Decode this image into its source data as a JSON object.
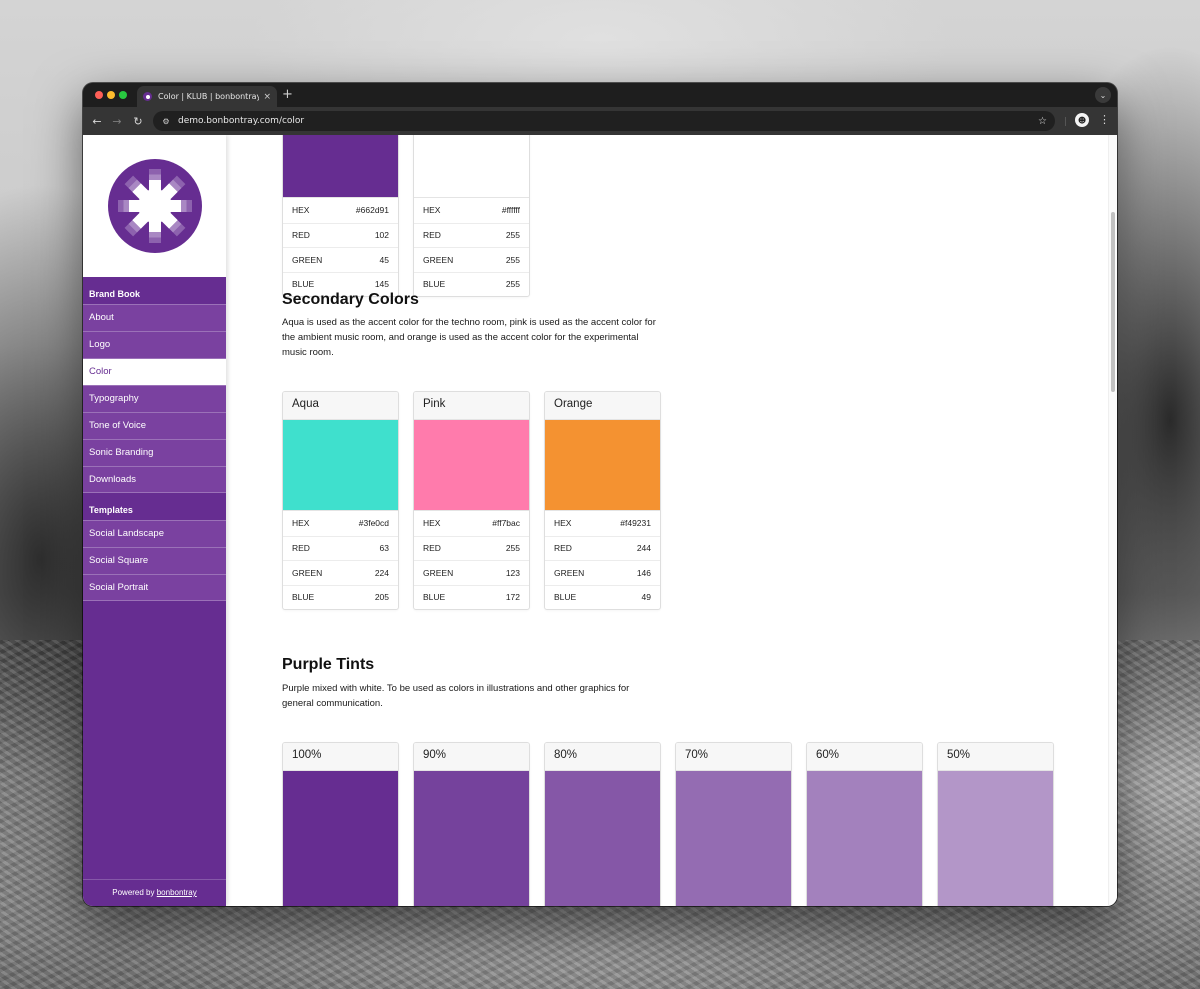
{
  "browser": {
    "tab_title": "Color | KLUB | bonbontray",
    "tab_close_icon": "×",
    "new_tab_icon": "+",
    "tab_dropdown_icon": "⌄",
    "back_icon": "←",
    "forward_icon": "→",
    "reload_icon": "↻",
    "site_info_icon": "⚙",
    "url": "demo.bonbontray.com/color",
    "bookmark_icon": "☆",
    "profile_icon": "☻",
    "menu_icon": "⋮"
  },
  "brand": {
    "primary_color": "#662d91",
    "logo_icon": "asterisk-burst-logo"
  },
  "sidebar": {
    "groups": [
      {
        "heading": "Brand Book",
        "items": [
          {
            "label": "About"
          },
          {
            "label": "Logo"
          },
          {
            "label": "Color",
            "active": true
          },
          {
            "label": "Typography"
          },
          {
            "label": "Tone of Voice"
          },
          {
            "label": "Sonic Branding"
          },
          {
            "label": "Downloads"
          }
        ]
      },
      {
        "heading": "Templates",
        "items": [
          {
            "label": "Social Landscape"
          },
          {
            "label": "Social Square"
          },
          {
            "label": "Social Portrait"
          }
        ]
      }
    ],
    "footer": {
      "prefix": "Powered by ",
      "link": "bonbontray"
    }
  },
  "row_labels": {
    "hex": "HEX",
    "red": "RED",
    "green": "GREEN",
    "blue": "BLUE"
  },
  "primary_colors": [
    {
      "hex": "#662d91",
      "red": "102",
      "green": "45",
      "blue": "145"
    },
    {
      "hex": "#ffffff",
      "red": "255",
      "green": "255",
      "blue": "255"
    }
  ],
  "secondary": {
    "title": "Secondary Colors",
    "description": "Aqua is used as the accent color for the techno room, pink is used as the accent color for the ambient music room, and orange is used as the accent color for the experimental music room.",
    "colors": [
      {
        "name": "Aqua",
        "hex": "#3fe0cd",
        "red": "63",
        "green": "224",
        "blue": "205"
      },
      {
        "name": "Pink",
        "hex": "#ff7bac",
        "red": "255",
        "green": "123",
        "blue": "172"
      },
      {
        "name": "Orange",
        "hex": "#f49231",
        "red": "244",
        "green": "146",
        "blue": "49"
      }
    ]
  },
  "tints": {
    "title": "Purple Tints",
    "description": "Purple mixed with white. To be used as colors in illustrations and other graphics for general communication.",
    "items": [
      {
        "label": "100%",
        "color": "#662d91"
      },
      {
        "label": "90%",
        "color": "#75429c"
      },
      {
        "label": "80%",
        "color": "#8557a7"
      },
      {
        "label": "70%",
        "color": "#946cb2"
      },
      {
        "label": "60%",
        "color": "#a381bd"
      },
      {
        "label": "50%",
        "color": "#b396c8"
      }
    ]
  }
}
